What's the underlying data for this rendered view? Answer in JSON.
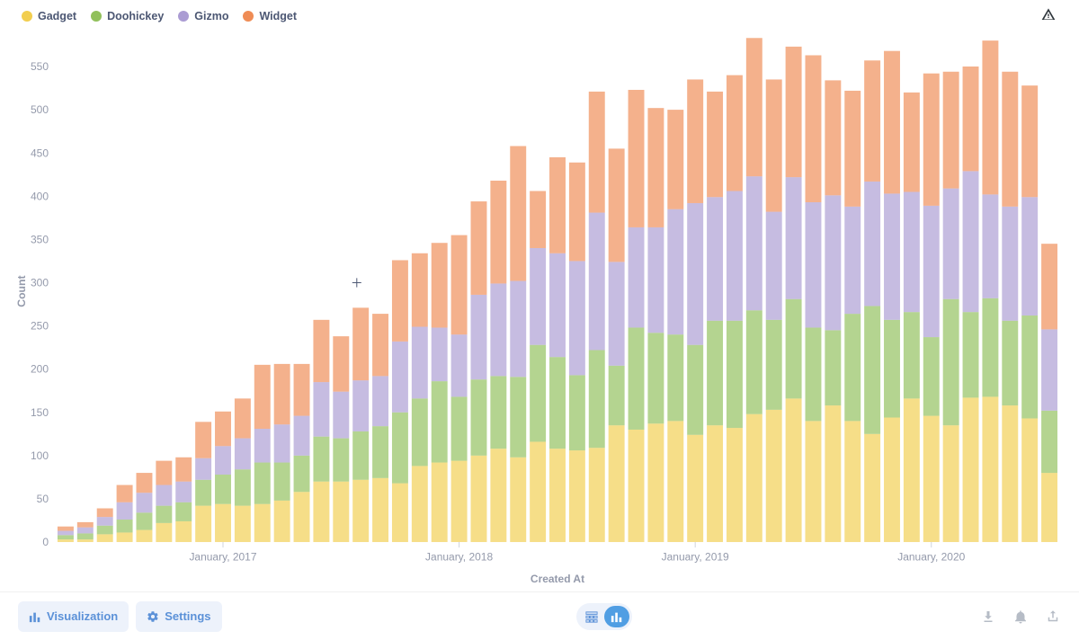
{
  "legend": [
    {
      "label": "Gadget",
      "color": "#f2ce4f"
    },
    {
      "label": "Doohickey",
      "color": "#91c05b"
    },
    {
      "label": "Gizmo",
      "color": "#ab9cd3"
    },
    {
      "label": "Widget",
      "color": "#ef8c55"
    }
  ],
  "footer": {
    "visualization_label": "Visualization",
    "settings_label": "Settings"
  },
  "chart_data": {
    "type": "bar",
    "stacked": true,
    "xlabel": "Created At",
    "ylabel": "Count",
    "ylim": [
      0,
      580
    ],
    "yticks": [
      0,
      50,
      100,
      150,
      200,
      250,
      300,
      350,
      400,
      450,
      500,
      550
    ],
    "xticks": [
      {
        "index": 8,
        "label": "January, 2017"
      },
      {
        "index": 20,
        "label": "January, 2018"
      },
      {
        "index": 32,
        "label": "January, 2019"
      },
      {
        "index": 44,
        "label": "January, 2020"
      }
    ],
    "series": [
      {
        "name": "Gadget",
        "color": "#f2ce4f"
      },
      {
        "name": "Doohickey",
        "color": "#91c05b"
      },
      {
        "name": "Gizmo",
        "color": "#ab9cd3"
      },
      {
        "name": "Widget",
        "color": "#ef8c55"
      }
    ],
    "categories_count": 49,
    "stacks": [
      {
        "gadget": 3,
        "doohickey": 5,
        "gizmo": 5,
        "widget": 5
      },
      {
        "gadget": 3,
        "doohickey": 7,
        "gizmo": 7,
        "widget": 6
      },
      {
        "gadget": 9,
        "doohickey": 10,
        "gizmo": 10,
        "widget": 10
      },
      {
        "gadget": 11,
        "doohickey": 15,
        "gizmo": 20,
        "widget": 20
      },
      {
        "gadget": 14,
        "doohickey": 20,
        "gizmo": 23,
        "widget": 23
      },
      {
        "gadget": 22,
        "doohickey": 20,
        "gizmo": 24,
        "widget": 28
      },
      {
        "gadget": 24,
        "doohickey": 22,
        "gizmo": 24,
        "widget": 28
      },
      {
        "gadget": 42,
        "doohickey": 30,
        "gizmo": 25,
        "widget": 42
      },
      {
        "gadget": 44,
        "doohickey": 34,
        "gizmo": 33,
        "widget": 40
      },
      {
        "gadget": 42,
        "doohickey": 42,
        "gizmo": 36,
        "widget": 46
      },
      {
        "gadget": 44,
        "doohickey": 48,
        "gizmo": 39,
        "widget": 74
      },
      {
        "gadget": 48,
        "doohickey": 44,
        "gizmo": 44,
        "widget": 70
      },
      {
        "gadget": 58,
        "doohickey": 42,
        "gizmo": 46,
        "widget": 60
      },
      {
        "gadget": 70,
        "doohickey": 52,
        "gizmo": 63,
        "widget": 72
      },
      {
        "gadget": 70,
        "doohickey": 50,
        "gizmo": 54,
        "widget": 64
      },
      {
        "gadget": 72,
        "doohickey": 56,
        "gizmo": 59,
        "widget": 84
      },
      {
        "gadget": 74,
        "doohickey": 60,
        "gizmo": 58,
        "widget": 72
      },
      {
        "gadget": 68,
        "doohickey": 82,
        "gizmo": 82,
        "widget": 94
      },
      {
        "gadget": 88,
        "doohickey": 78,
        "gizmo": 83,
        "widget": 85
      },
      {
        "gadget": 92,
        "doohickey": 94,
        "gizmo": 62,
        "widget": 98
      },
      {
        "gadget": 94,
        "doohickey": 74,
        "gizmo": 72,
        "widget": 115
      },
      {
        "gadget": 100,
        "doohickey": 88,
        "gizmo": 98,
        "widget": 108
      },
      {
        "gadget": 108,
        "doohickey": 84,
        "gizmo": 107,
        "widget": 119
      },
      {
        "gadget": 98,
        "doohickey": 93,
        "gizmo": 111,
        "widget": 156
      },
      {
        "gadget": 116,
        "doohickey": 112,
        "gizmo": 112,
        "widget": 66
      },
      {
        "gadget": 108,
        "doohickey": 106,
        "gizmo": 120,
        "widget": 111
      },
      {
        "gadget": 106,
        "doohickey": 87,
        "gizmo": 132,
        "widget": 114
      },
      {
        "gadget": 109,
        "doohickey": 113,
        "gizmo": 159,
        "widget": 140
      },
      {
        "gadget": 135,
        "doohickey": 69,
        "gizmo": 120,
        "widget": 131
      },
      {
        "gadget": 130,
        "doohickey": 118,
        "gizmo": 116,
        "widget": 159
      },
      {
        "gadget": 137,
        "doohickey": 105,
        "gizmo": 122,
        "widget": 138
      },
      {
        "gadget": 140,
        "doohickey": 100,
        "gizmo": 145,
        "widget": 115
      },
      {
        "gadget": 124,
        "doohickey": 104,
        "gizmo": 164,
        "widget": 143
      },
      {
        "gadget": 135,
        "doohickey": 121,
        "gizmo": 143,
        "widget": 122
      },
      {
        "gadget": 132,
        "doohickey": 124,
        "gizmo": 150,
        "widget": 134
      },
      {
        "gadget": 148,
        "doohickey": 120,
        "gizmo": 155,
        "widget": 160
      },
      {
        "gadget": 153,
        "doohickey": 104,
        "gizmo": 125,
        "widget": 153
      },
      {
        "gadget": 166,
        "doohickey": 115,
        "gizmo": 141,
        "widget": 151
      },
      {
        "gadget": 140,
        "doohickey": 108,
        "gizmo": 145,
        "widget": 170
      },
      {
        "gadget": 158,
        "doohickey": 87,
        "gizmo": 156,
        "widget": 133
      },
      {
        "gadget": 140,
        "doohickey": 124,
        "gizmo": 124,
        "widget": 134
      },
      {
        "gadget": 125,
        "doohickey": 148,
        "gizmo": 144,
        "widget": 140
      },
      {
        "gadget": 144,
        "doohickey": 113,
        "gizmo": 146,
        "widget": 165
      },
      {
        "gadget": 166,
        "doohickey": 100,
        "gizmo": 139,
        "widget": 115
      },
      {
        "gadget": 146,
        "doohickey": 91,
        "gizmo": 152,
        "widget": 153
      },
      {
        "gadget": 135,
        "doohickey": 146,
        "gizmo": 128,
        "widget": 135
      },
      {
        "gadget": 167,
        "doohickey": 99,
        "gizmo": 163,
        "widget": 121
      },
      {
        "gadget": 168,
        "doohickey": 114,
        "gizmo": 120,
        "widget": 178
      },
      {
        "gadget": 158,
        "doohickey": 98,
        "gizmo": 132,
        "widget": 156
      },
      {
        "gadget": 143,
        "doohickey": 119,
        "gizmo": 137,
        "widget": 129
      },
      {
        "gadget": 80,
        "doohickey": 72,
        "gizmo": 94,
        "widget": 99
      }
    ]
  }
}
